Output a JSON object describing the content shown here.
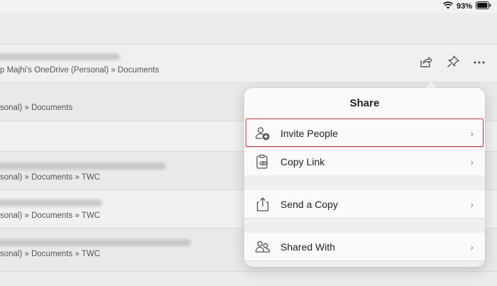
{
  "status": {
    "battery_label": "93%"
  },
  "rows": [
    {
      "path": "p Majhi's OneDrive (Personal) » Documents"
    },
    {
      "path": "sonal) » Documents"
    },
    {
      "path": ""
    },
    {
      "path": "sonal) » Documents » TWC"
    },
    {
      "path": "sonal) » Documents » TWC"
    },
    {
      "path": "sonal) » Documents » TWC"
    }
  ],
  "row_actions": [
    "share-icon",
    "pin-icon",
    "more-icon"
  ],
  "share_popover": {
    "title": "Share",
    "items": [
      {
        "label": "Invite People",
        "icon": "invite-person-icon"
      },
      {
        "label": "Copy Link",
        "icon": "copy-link-icon"
      },
      {
        "label": "Send a Copy",
        "icon": "send-copy-icon"
      },
      {
        "label": "Shared With",
        "icon": "shared-with-icon"
      }
    ]
  },
  "colors": {
    "highlight": "#c0393b",
    "accent_text": "#222222"
  }
}
